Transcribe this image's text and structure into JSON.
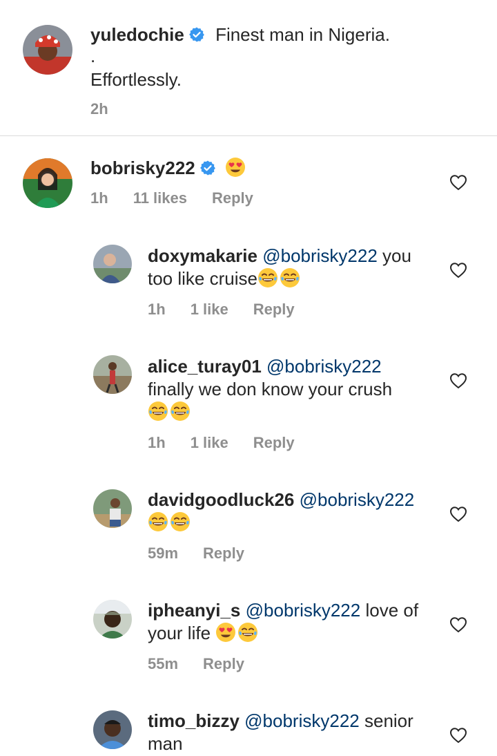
{
  "caption": {
    "username": "yuledochie",
    "text": "Finest man in Nigeria.",
    "dot": ".",
    "line2": "Effortlessly.",
    "time": "2h"
  },
  "comment": {
    "username": "bobrisky222",
    "emoji": "heart-eyes",
    "time": "1h",
    "likes": "11 likes",
    "reply": "Reply"
  },
  "replies": [
    {
      "username": "doxymakarie",
      "mention": "@bobrisky222",
      "text_a": "you",
      "text_b": "too like cruise",
      "emojis": [
        "laughing",
        "laughing"
      ],
      "time": "1h",
      "likes": "1 like",
      "reply": "Reply"
    },
    {
      "username": "alice_turay01",
      "mention": "@bobrisky222",
      "text_b": "finally we don know your crush",
      "emojis": [
        "laughing",
        "laughing"
      ],
      "time": "1h",
      "likes": "1 like",
      "reply": "Reply"
    },
    {
      "username": "davidgoodluck26",
      "mention": "@bobrisky222",
      "emojis": [
        "laughing",
        "laughing"
      ],
      "time": "59m",
      "reply": "Reply"
    },
    {
      "username": "ipheanyi_s",
      "mention": "@bobrisky222",
      "text_a": "love of",
      "text_b": "your life",
      "emojis": [
        "heart-eyes",
        "laughing"
      ],
      "time": "55m",
      "reply": "Reply"
    },
    {
      "username": "timo_bizzy",
      "mention": "@bobrisky222",
      "text_a": "senior",
      "text_b": "man"
    }
  ],
  "colors": {
    "verified": "#3897f0",
    "mention": "#00376b",
    "meta": "#8e8e8e"
  }
}
